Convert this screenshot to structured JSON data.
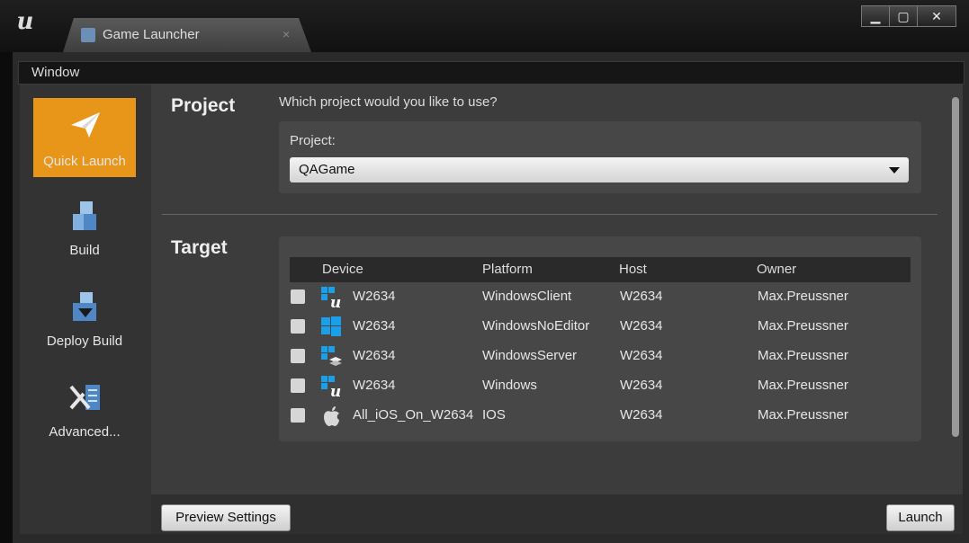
{
  "window": {
    "tab_label": "Game Launcher",
    "tab_close": "×",
    "controls": {
      "minimize": "▁",
      "maximize": "▢",
      "close": "✕"
    }
  },
  "menu": {
    "window": "Window"
  },
  "sidebar": {
    "items": [
      {
        "label": "Quick Launch",
        "icon": "paper-plane-icon",
        "active": true
      },
      {
        "label": "Build",
        "icon": "build-blocks-icon",
        "active": false
      },
      {
        "label": "Deploy Build",
        "icon": "deploy-icon",
        "active": false
      },
      {
        "label": "Advanced...",
        "icon": "tools-icon",
        "active": false
      }
    ]
  },
  "project": {
    "section_title": "Project",
    "question": "Which project would you like to use?",
    "field_label": "Project:",
    "selected": "QAGame"
  },
  "target": {
    "section_title": "Target",
    "columns": [
      "Device",
      "Platform",
      "Host",
      "Owner"
    ],
    "rows": [
      {
        "device": "W2634",
        "platform": "WindowsClient",
        "host": "W2634",
        "owner": "Max.Preussner",
        "icon": "windows-unreal-icon"
      },
      {
        "device": "W2634",
        "platform": "WindowsNoEditor",
        "host": "W2634",
        "owner": "Max.Preussner",
        "icon": "windows-icon"
      },
      {
        "device": "W2634",
        "platform": "WindowsServer",
        "host": "W2634",
        "owner": "Max.Preussner",
        "icon": "windows-server-icon"
      },
      {
        "device": "W2634",
        "platform": "Windows",
        "host": "W2634",
        "owner": "Max.Preussner",
        "icon": "windows-unreal-icon"
      },
      {
        "device": "All_iOS_On_W2634",
        "platform": "IOS",
        "host": "W2634",
        "owner": "Max.Preussner",
        "icon": "apple-icon"
      }
    ]
  },
  "footer": {
    "preview_settings": "Preview Settings",
    "launch": "Launch"
  },
  "colors": {
    "accent": "#e8961a",
    "windows_blue": "#1a9fe8"
  }
}
